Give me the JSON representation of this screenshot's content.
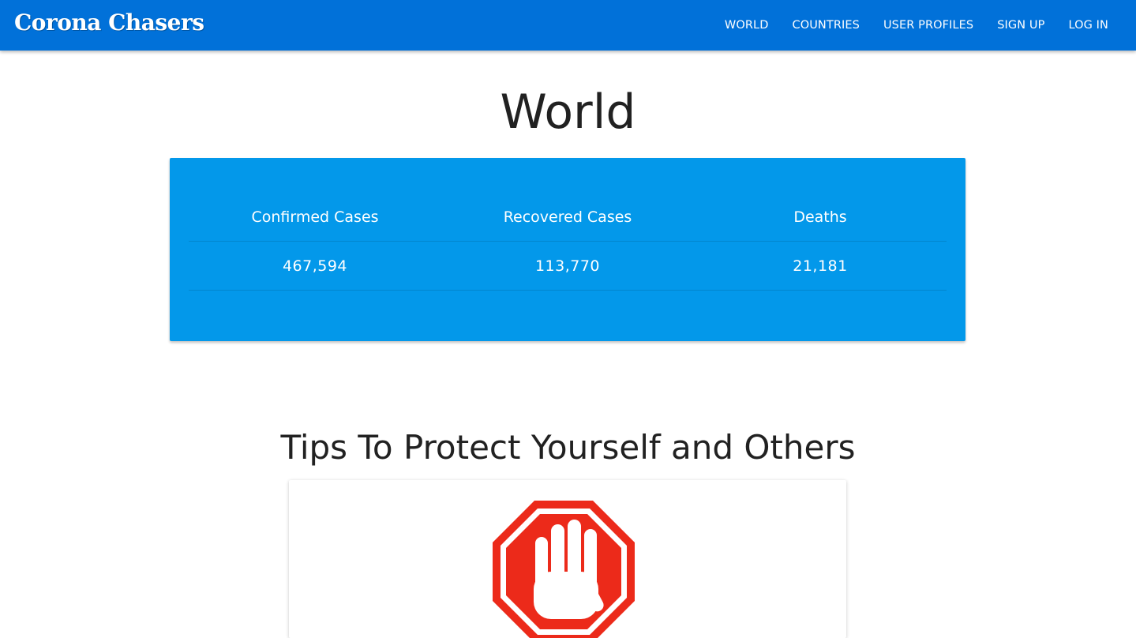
{
  "navbar": {
    "brand": "Corona Chasers",
    "links": [
      "WORLD",
      "COUNTRIES",
      "USER PROFILES",
      "SIGN UP",
      "LOG IN"
    ]
  },
  "page": {
    "title": "World"
  },
  "stats": {
    "headers": {
      "confirmed": "Confirmed Cases",
      "recovered": "Recovered Cases",
      "deaths": "Deaths"
    },
    "values": {
      "confirmed": "467,594",
      "recovered": "113,770",
      "deaths": "21,181"
    }
  },
  "tips": {
    "title": "Tips To Protect Yourself and Others",
    "first_card_icon": "stop-hand-icon"
  },
  "colors": {
    "navbar": "#0171d9",
    "stats_panel": "#0398ea",
    "stop_sign": "#ec2a1a"
  }
}
